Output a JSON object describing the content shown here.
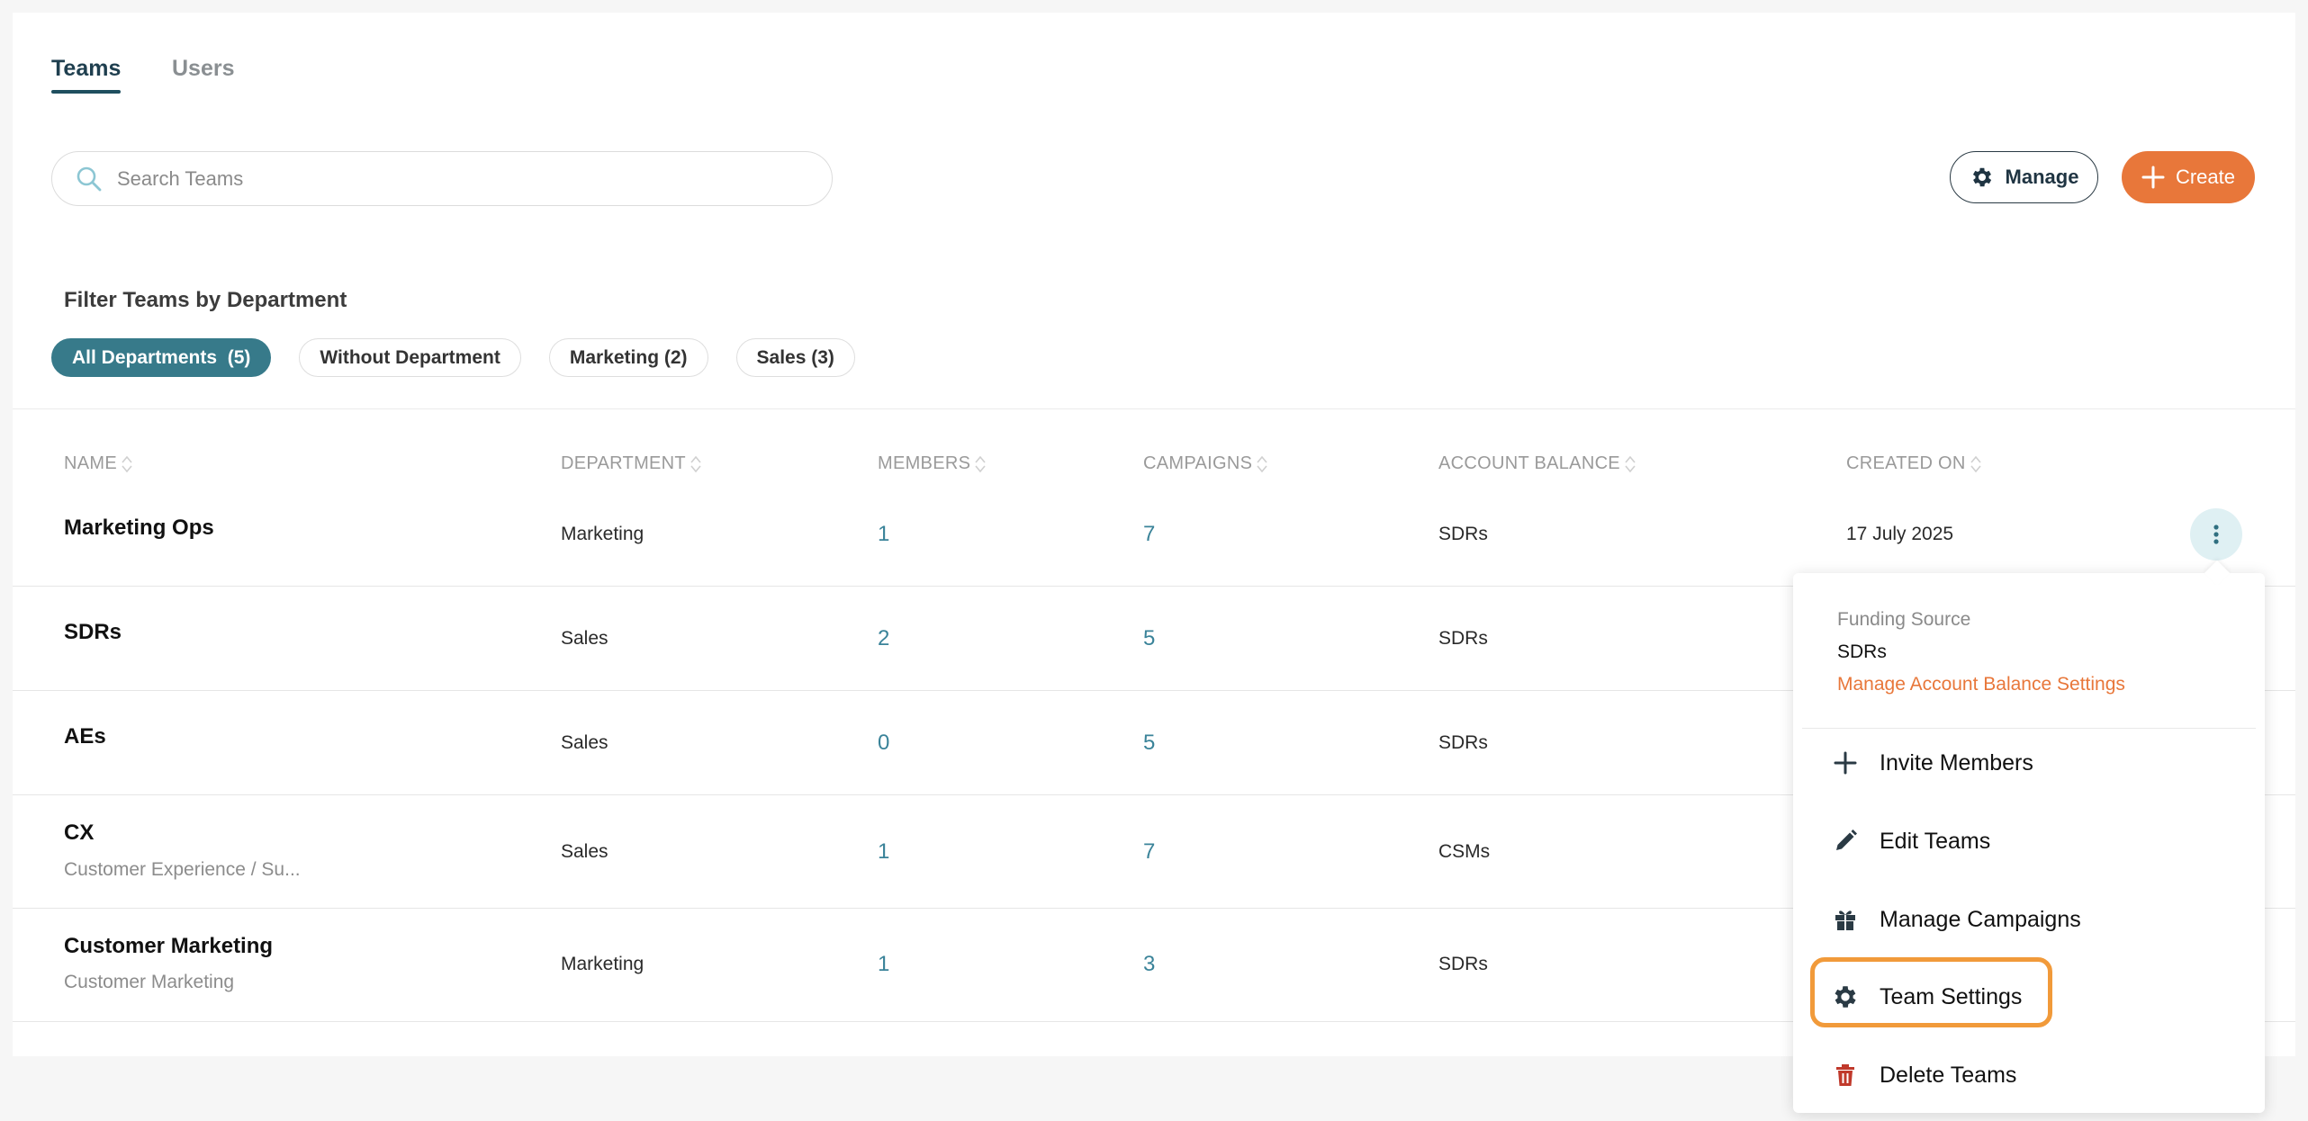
{
  "tabs": [
    {
      "label": "Teams",
      "active": true
    },
    {
      "label": "Users",
      "active": false
    }
  ],
  "search": {
    "placeholder": "Search Teams",
    "value": ""
  },
  "actions": {
    "manage_label": "Manage",
    "create_label": "Create"
  },
  "colors": {
    "accent_teal": "#377a8a",
    "brand_orange": "#e8773a",
    "link_blue": "#3a8399",
    "delete_red": "#c0392b"
  },
  "filters": {
    "title": "Filter Teams by Department",
    "chips": [
      {
        "label": "All Departments  (5)",
        "active": true
      },
      {
        "label": "Without Department",
        "active": false
      },
      {
        "label": "Marketing (2)",
        "active": false
      },
      {
        "label": "Sales (3)",
        "active": false
      }
    ]
  },
  "table": {
    "columns": [
      "NAME",
      "DEPARTMENT",
      "MEMBERS",
      "CAMPAIGNS",
      "ACCOUNT BALANCE",
      "CREATED ON"
    ],
    "rows": [
      {
        "name": "Marketing Ops",
        "subtitle": "",
        "department": "Marketing",
        "members": "1",
        "campaigns": "7",
        "balance": "SDRs",
        "created": "17 July 2025"
      },
      {
        "name": "SDRs",
        "subtitle": "",
        "department": "Sales",
        "members": "2",
        "campaigns": "5",
        "balance": "SDRs",
        "created": ""
      },
      {
        "name": "AEs",
        "subtitle": "",
        "department": "Sales",
        "members": "0",
        "campaigns": "5",
        "balance": "SDRs",
        "created": ""
      },
      {
        "name": "CX",
        "subtitle": "Customer Experience / Su...",
        "department": "Sales",
        "members": "1",
        "campaigns": "7",
        "balance": "CSMs",
        "created": ""
      },
      {
        "name": "Customer Marketing",
        "subtitle": "Customer Marketing",
        "department": "Marketing",
        "members": "1",
        "campaigns": "3",
        "balance": "SDRs",
        "created": ""
      }
    ]
  },
  "dropdown": {
    "funding_label": "Funding Source",
    "funding_value": "SDRs",
    "funding_link": "Manage Account Balance Settings",
    "items": [
      {
        "label": "Invite Members",
        "icon": "plus-icon"
      },
      {
        "label": "Edit Teams",
        "icon": "pencil-icon"
      },
      {
        "label": "Manage Campaigns",
        "icon": "gift-icon"
      },
      {
        "label": "Team Settings",
        "icon": "gear-icon",
        "highlighted": true
      },
      {
        "label": "Delete Teams",
        "icon": "trash-icon"
      }
    ]
  }
}
